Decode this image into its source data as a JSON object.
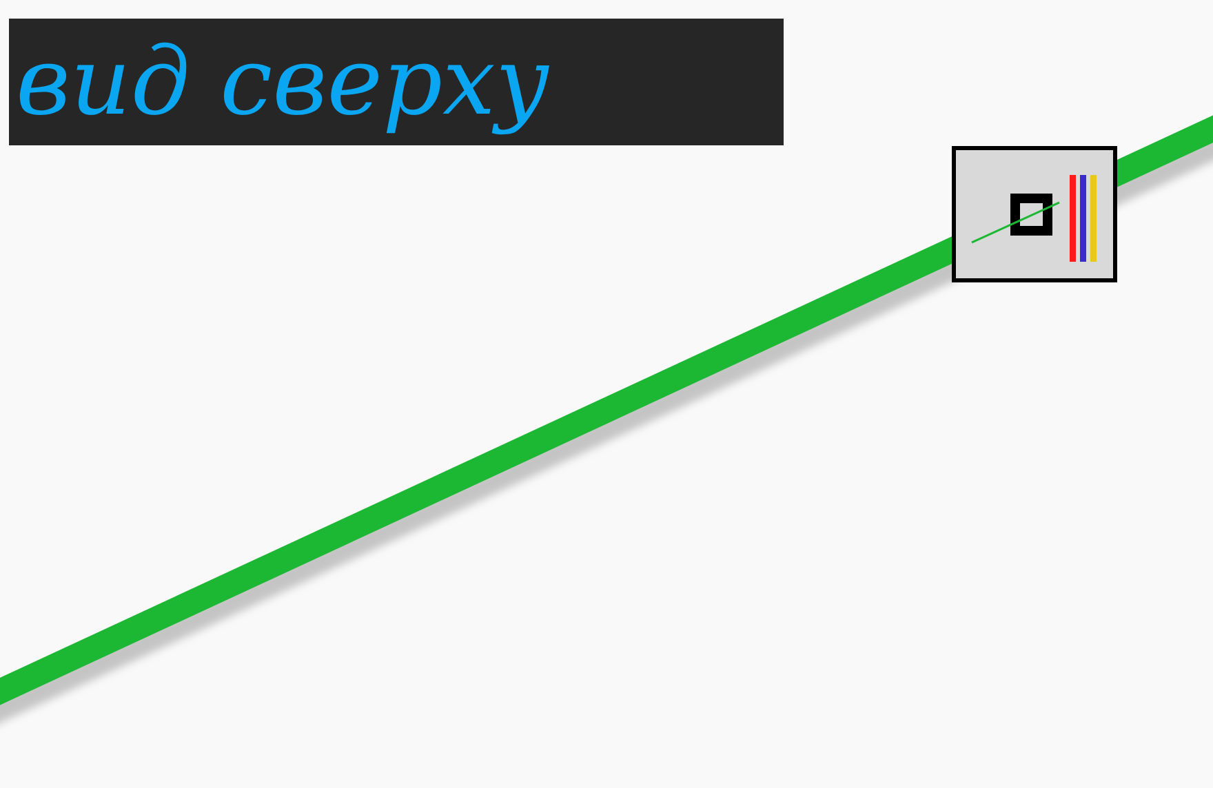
{
  "title_banner": {
    "text": "вид сверху",
    "text_color": "#0aa6f2",
    "background_color": "#262626"
  },
  "scene": {
    "background_color": "#f9f9f9",
    "track_color": "#1cb733",
    "shadow_color": "#9a9a9a"
  },
  "legend_widget": {
    "background_color": "#d9d9d9",
    "border_color": "#000000",
    "icon_line_color": "#1cb733",
    "icon_square_color": "#000000",
    "stripe_colors": [
      "#ff1a1a",
      "#3a2bcc",
      "#e8c81e"
    ]
  }
}
